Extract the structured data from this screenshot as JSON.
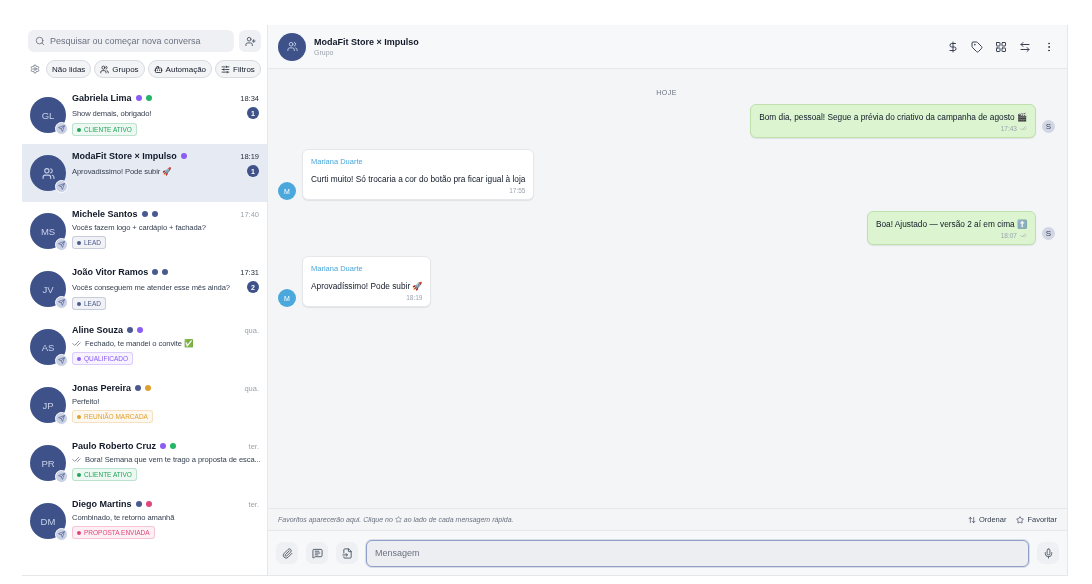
{
  "search": {
    "placeholder": "Pesquisar ou começar nova conversa"
  },
  "filters": [
    {
      "label": "Não lidas",
      "kind": "plain"
    },
    {
      "label": "Grupos",
      "kind": "users"
    },
    {
      "label": "Automação",
      "kind": "bot"
    },
    {
      "label": "Filtros",
      "kind": "sliders"
    }
  ],
  "conversations": [
    {
      "name": "Gabriela Lima",
      "initials": "GL",
      "kind": "person",
      "dots": [
        {
          "color": "#8b5cf6"
        },
        {
          "color": "#22b565"
        }
      ],
      "time": "18:34",
      "preview": "Show demais, obrigado!",
      "read_ticks": false,
      "unread": "1",
      "tag": {
        "label": "CLIENTE ATIVO",
        "color": "#22a55b"
      },
      "selected": false
    },
    {
      "name": "ModaFit Store × Impulso",
      "kind": "group",
      "dots": [
        {
          "color": "#8b5cf6"
        }
      ],
      "time": "18:19",
      "preview": "Aprovadíssimo! Pode subir 🚀",
      "read_ticks": false,
      "unread": "1",
      "selected": true
    },
    {
      "name": "Michele Santos",
      "initials": "MS",
      "kind": "person",
      "dots": [
        {
          "color": "#4a5a8f"
        },
        {
          "color": "#4a5a8f"
        }
      ],
      "time": "17:40",
      "preview": "Vocês fazem logo + cardápio + fachada?",
      "read_ticks": false,
      "tag": {
        "label": "LEAD",
        "color": "#4a5a8f"
      },
      "selected": false
    },
    {
      "name": "João Vitor Ramos",
      "initials": "JV",
      "kind": "person",
      "dots": [
        {
          "color": "#4a5a8f"
        },
        {
          "color": "#4a5a8f"
        }
      ],
      "time": "17:31",
      "preview": "Vocês conseguem me atender esse mês ainda?",
      "read_ticks": false,
      "unread": "2",
      "tag": {
        "label": "LEAD",
        "color": "#4a5a8f"
      },
      "selected": false
    },
    {
      "name": "Aline Souza",
      "initials": "AS",
      "kind": "person",
      "dots": [
        {
          "color": "#4a5a8f"
        },
        {
          "color": "#8b5cf6"
        }
      ],
      "time": "qua.",
      "preview": "Fechado, te mandei o convite ✅",
      "read_ticks": true,
      "tag": {
        "label": "QUALIFICADO",
        "color": "#8b5cf6"
      },
      "selected": false
    },
    {
      "name": "Jonas Pereira",
      "initials": "JP",
      "kind": "person",
      "dots": [
        {
          "color": "#4a5a8f"
        },
        {
          "color": "#e0a030"
        }
      ],
      "time": "qua.",
      "preview": "Perfeito!",
      "read_ticks": false,
      "tag": {
        "label": "REUNIÃO MARCADA",
        "color": "#e0a030"
      },
      "selected": false
    },
    {
      "name": "Paulo Roberto Cruz",
      "initials": "PR",
      "kind": "person",
      "dots": [
        {
          "color": "#8b5cf6"
        },
        {
          "color": "#22b565"
        }
      ],
      "time": "ter.",
      "preview": "Bora! Semana que vem te trago a proposta de esca...",
      "read_ticks": true,
      "tag": {
        "label": "CLIENTE ATIVO",
        "color": "#22a55b"
      },
      "selected": false
    },
    {
      "name": "Diego Martins",
      "initials": "DM",
      "kind": "person",
      "dots": [
        {
          "color": "#4a5a8f"
        },
        {
          "color": "#e0457b"
        }
      ],
      "time": "ter.",
      "preview": "Combinado, te retorno amanhã",
      "read_ticks": false,
      "tag": {
        "label": "PROPOSTA ENVIADA",
        "color": "#e0457b"
      },
      "selected": false
    }
  ],
  "chat": {
    "title": "ModaFit Store × Impulso",
    "subtitle": "Grupo",
    "day": "HOJE",
    "messages": [
      {
        "kind": "out",
        "text": "Bom dia, pessoal! Segue a prévia do criativo da campanha de agosto 🎬",
        "time": "17:43",
        "avatar": "S"
      },
      {
        "kind": "in",
        "sender": "Mariana Duarte",
        "text": "Curti muito! Só trocaria a cor do botão pra ficar igual à loja",
        "time": "17:55",
        "avatar": "M"
      },
      {
        "kind": "out",
        "text": "Boa! Ajustado — versão 2 aí em cima ⬆️",
        "time": "18:07",
        "avatar": "S"
      },
      {
        "kind": "in",
        "sender": "Mariana Duarte",
        "text": "Aprovadíssimo! Pode subir 🚀",
        "time": "18:19",
        "avatar": "M"
      }
    ]
  },
  "favorites": {
    "hint_before": "Favoritos aparecerão aqui. Clique no",
    "hint_after": "ao lado de cada mensagem rápida.",
    "sort": "Ordenar",
    "favorite": "Favoritar"
  },
  "composer": {
    "placeholder": "Mensagem"
  }
}
